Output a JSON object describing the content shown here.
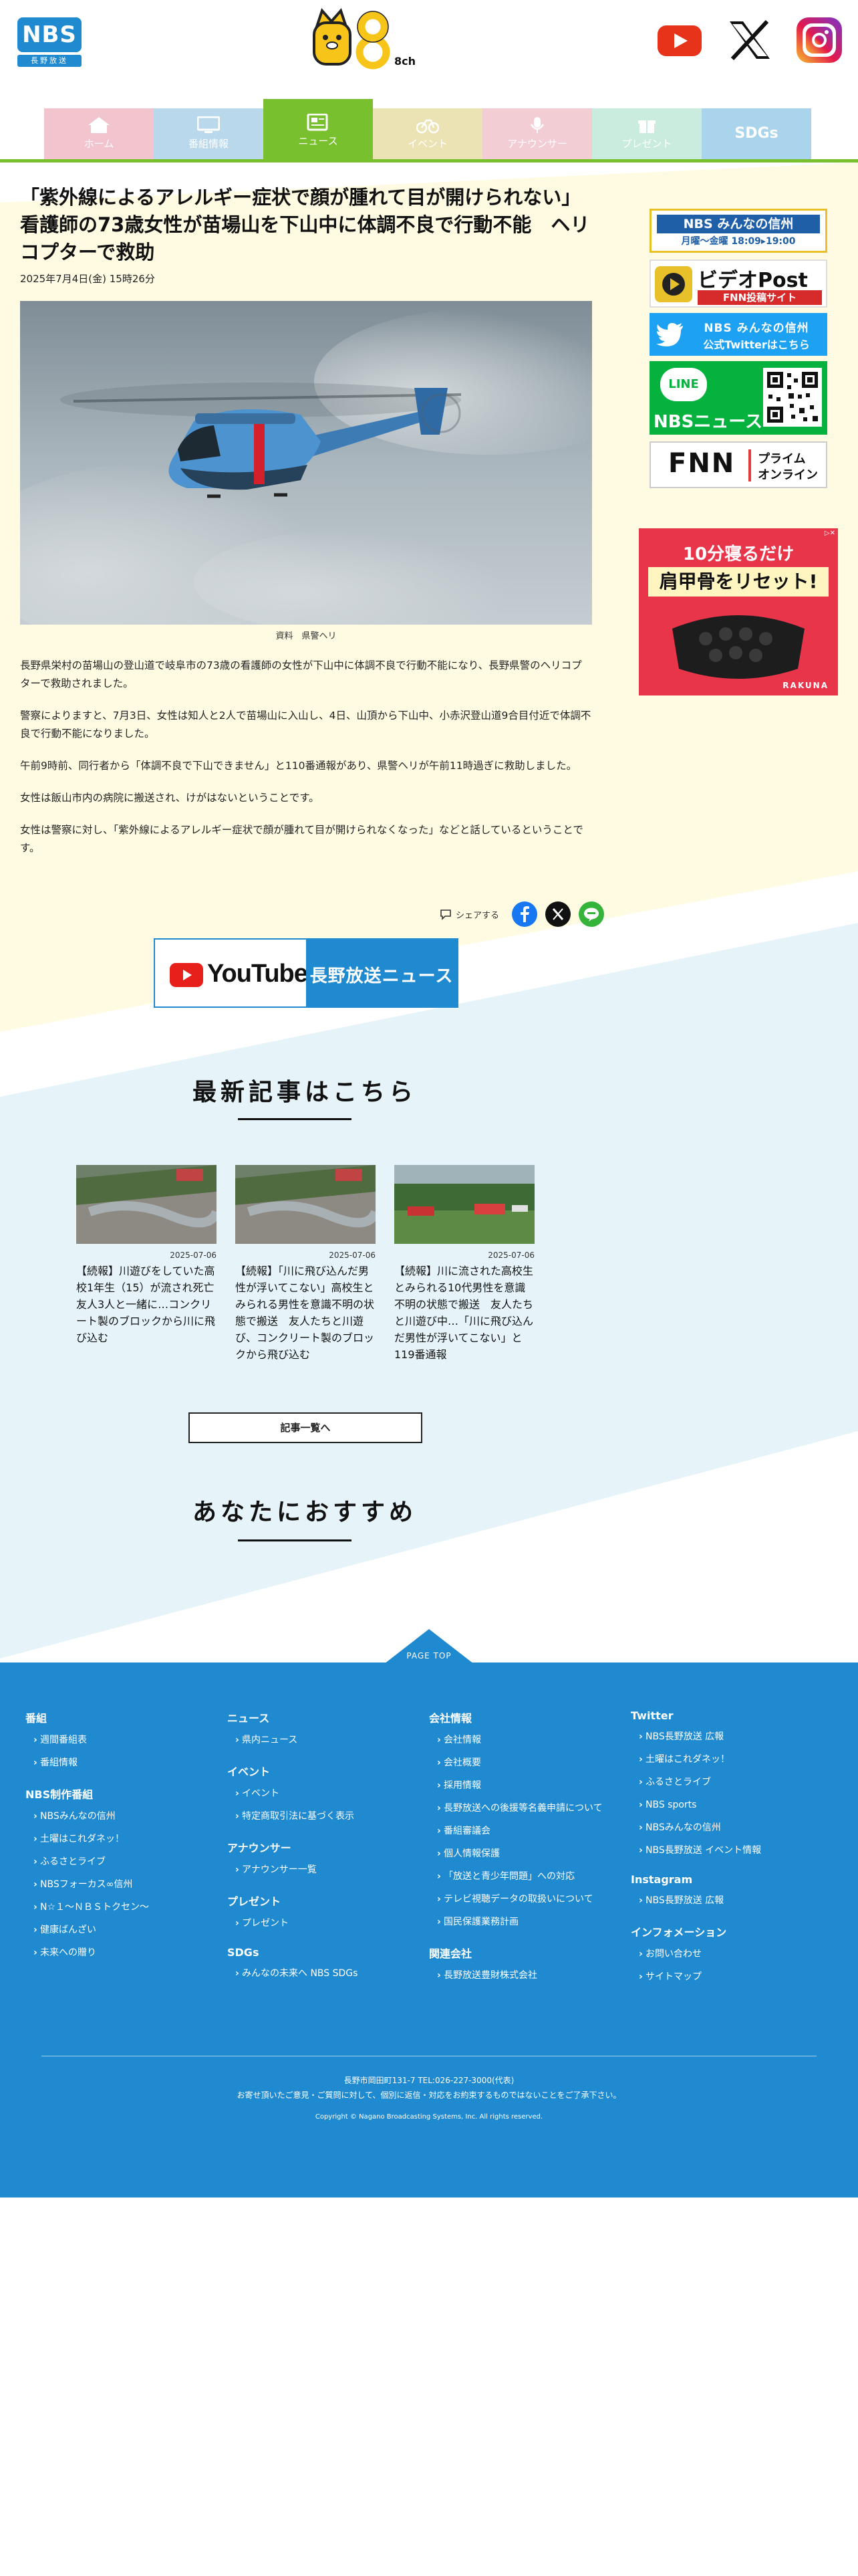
{
  "header": {
    "logo_text": "NBS",
    "logo_sub": "長野放送",
    "channel_logo_text": "8ch"
  },
  "nav": [
    {
      "label": "ホーム",
      "icon": "home-icon",
      "color": "#f2c4ce"
    },
    {
      "label": "番組情報",
      "icon": "tv-icon",
      "color": "#b9d8eb"
    },
    {
      "label": "ニュース",
      "icon": "news-icon",
      "color": "#78c02e"
    },
    {
      "label": "イベント",
      "icon": "bicycle-icon",
      "color": "#ece3b4"
    },
    {
      "label": "アナウンサー",
      "icon": "microphone-icon",
      "color": "#f3cdd4"
    },
    {
      "label": "プレゼント",
      "icon": "gift-icon",
      "color": "#c9ecde"
    },
    {
      "label": "SDGs",
      "icon": "sdgs-icon",
      "color": "#aad4ec"
    }
  ],
  "article": {
    "title": "「紫外線によるアレルギー症状で顔が腫れて目が開けられない」看護師の73歳女性が苗場山を下山中に体調不良で行動不能　ヘリコプターで救助",
    "date": "2025年7月4日(金) 15時26分",
    "photo_caption": "資料　県警ヘリ",
    "paragraphs": [
      "長野県栄村の苗場山の登山道で岐阜市の73歳の看護師の女性が下山中に体調不良で行動不能になり、長野県警のヘリコプターで救助されました。",
      "警察によりますと、7月3日、女性は知人と2人で苗場山に入山し、4日、山頂から下山中、小赤沢登山道9合目付近で体調不良で行動不能になりました。",
      "午前9時前、同行者から「体調不良で下山できません」と110番通報があり、県警ヘリが午前11時過ぎに救助しました。",
      "女性は飯山市内の病院に搬送され、けがはないということです。",
      "女性は警察に対し、「紫外線によるアレルギー症状で顔が腫れて目が開けられなくなった」などと話しているということです。"
    ],
    "share_label": "シェアする",
    "youtube_word": "YouTube",
    "youtube_channel": "長野放送ニュース"
  },
  "sidebar": {
    "banner1_main": "NBS みんなの信州",
    "banner1_sub": "月曜～金曜 18:09▸19:00",
    "banner2_main": "ビデオPost",
    "banner2_sub": "FNN投稿サイト",
    "banner3_line1": "NBS みんなの信州",
    "banner3_line2": "公式Twitterはこちら",
    "banner4_line": "LINE",
    "banner4_main": "NBSニュース",
    "banner5_logo": "FNN",
    "banner5_sub1": "プライム",
    "banner5_sub2": "オンライン",
    "ad_line1": "10分寝るだけ",
    "ad_line2": "肩甲骨をリセット!",
    "ad_brand": "RAKUNA"
  },
  "latest": {
    "heading": "最新記事はこちら",
    "cards": [
      {
        "date": "2025-07-06",
        "title": "【続報】川遊びをしていた高校1年生（15）が流され死亡　友人3人と一緒に…コンクリート製のブロックから川に飛び込む"
      },
      {
        "date": "2025-07-06",
        "title": "【続報】「川に飛び込んだ男性が浮いてこない」高校生とみられる男性を意識不明の状態で搬送　友人たちと川遊び、コンクリート製のブロックから飛び込む"
      },
      {
        "date": "2025-07-06",
        "title": "【続報】川に流された高校生とみられる10代男性を意識不明の状態で搬送　友人たちと川遊び中…「川に飛び込んだ男性が浮いてこない」と119番通報"
      }
    ],
    "more_button": "記事一覧へ"
  },
  "recommend": {
    "heading": "あなたにおすすめ"
  },
  "footer": {
    "pagetop": "PAGE TOP",
    "columns": [
      [
        {
          "head": "番組",
          "items": [
            "週間番組表",
            "番組情報"
          ]
        },
        {
          "head": "NBS制作番組",
          "items": [
            "NBSみんなの信州",
            "土曜はこれダネッ！",
            "ふるさとライブ",
            "NBSフォーカス∞信州",
            "N☆１～ＮＢＳトクセン～",
            "健康ばんざい",
            "未来への贈り"
          ]
        }
      ],
      [
        {
          "head": "ニュース",
          "items": [
            "県内ニュース"
          ]
        },
        {
          "head": "イベント",
          "items": [
            "イベント",
            "特定商取引法に基づく表示"
          ]
        },
        {
          "head": "アナウンサー",
          "items": [
            "アナウンサー一覧"
          ]
        },
        {
          "head": "プレゼント",
          "items": [
            "プレゼント"
          ]
        },
        {
          "head": "SDGs",
          "items": [
            "みんなの未来へ NBS SDGs"
          ]
        }
      ],
      [
        {
          "head": "会社情報",
          "items": [
            "会社情報",
            "会社概要",
            "採用情報",
            "長野放送への後援等名義申請について",
            "番組審議会",
            "個人情報保護",
            "「放送と青少年問題」への対応",
            "テレビ視聴データの取扱いについて",
            "国民保護業務計画"
          ]
        },
        {
          "head": "関連会社",
          "items": [
            "長野放送豊財株式会社"
          ]
        }
      ],
      [
        {
          "head": "Twitter",
          "items": [
            "NBS長野放送 広報",
            "土曜はこれダネッ！",
            "ふるさとライブ",
            "NBS sports",
            "NBSみんなの信州",
            "NBS長野放送 イベント情報"
          ]
        },
        {
          "head": "Instagram",
          "items": [
            "NBS長野放送 広報"
          ]
        },
        {
          "head": "インフォメーション",
          "items": [
            "お問い合わせ",
            "サイトマップ"
          ]
        }
      ]
    ],
    "address": "長野市岡田町131-7 TEL:026-227-3000(代表)",
    "notice": "お寄せ頂いたご意見・ご質問に対して、個別に返信・対応をお約束するものではないことをご了承下さい。",
    "copyright": "Copyright © Nagano Broadcasting Systems, Inc. All rights reserved."
  }
}
